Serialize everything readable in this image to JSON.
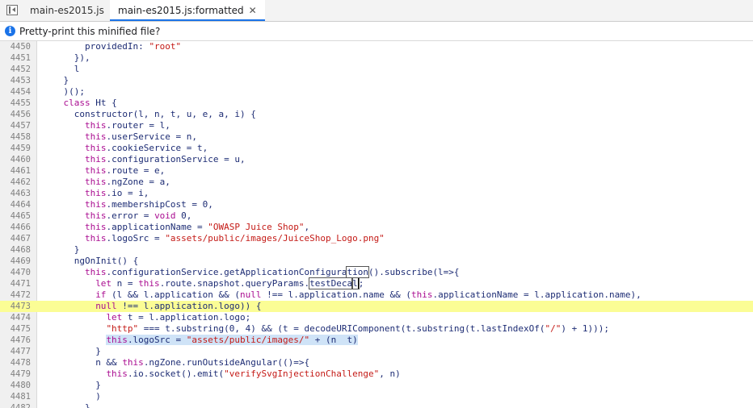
{
  "tabs": [
    {
      "label": "main-es2015.js",
      "active": false
    },
    {
      "label": "main-es2015.js:formatted",
      "active": true,
      "close": "✕"
    }
  ],
  "infobar": {
    "text": "Pretty-print this minified file?",
    "icon": "info-icon"
  },
  "accent": "#1a73e8",
  "highlight_color": "#fbfd95",
  "lines": [
    {
      "n": "4450",
      "ind": 8,
      "segs": [
        [
          "t",
          "providedIn: "
        ],
        [
          "s",
          "\"root\""
        ]
      ]
    },
    {
      "n": "4451",
      "ind": 6,
      "segs": [
        [
          "t",
          "}),"
        ]
      ]
    },
    {
      "n": "4452",
      "ind": 6,
      "segs": [
        [
          "t",
          "l"
        ]
      ]
    },
    {
      "n": "4453",
      "ind": 4,
      "segs": [
        [
          "t",
          "}"
        ]
      ]
    },
    {
      "n": "4454",
      "ind": 4,
      "segs": [
        [
          "t",
          ")();"
        ]
      ]
    },
    {
      "n": "4455",
      "ind": 4,
      "segs": [
        [
          "k",
          "class"
        ],
        [
          "t",
          " Ht {"
        ]
      ]
    },
    {
      "n": "4456",
      "ind": 6,
      "segs": [
        [
          "t",
          "constructor(l, n, t, u, e, a, i) {"
        ]
      ]
    },
    {
      "n": "4457",
      "ind": 8,
      "segs": [
        [
          "k",
          "this"
        ],
        [
          "t",
          ".router = l,"
        ]
      ]
    },
    {
      "n": "4458",
      "ind": 8,
      "segs": [
        [
          "k",
          "this"
        ],
        [
          "t",
          ".userService = n,"
        ]
      ]
    },
    {
      "n": "4459",
      "ind": 8,
      "segs": [
        [
          "k",
          "this"
        ],
        [
          "t",
          ".cookieService = t,"
        ]
      ]
    },
    {
      "n": "4460",
      "ind": 8,
      "segs": [
        [
          "k",
          "this"
        ],
        [
          "t",
          ".configurationService = u,"
        ]
      ]
    },
    {
      "n": "4461",
      "ind": 8,
      "segs": [
        [
          "k",
          "this"
        ],
        [
          "t",
          ".route = e,"
        ]
      ]
    },
    {
      "n": "4462",
      "ind": 8,
      "segs": [
        [
          "k",
          "this"
        ],
        [
          "t",
          ".ngZone = a,"
        ]
      ]
    },
    {
      "n": "4463",
      "ind": 8,
      "segs": [
        [
          "k",
          "this"
        ],
        [
          "t",
          ".io = i,"
        ]
      ]
    },
    {
      "n": "4464",
      "ind": 8,
      "segs": [
        [
          "k",
          "this"
        ],
        [
          "t",
          ".membershipCost = 0,"
        ]
      ]
    },
    {
      "n": "4465",
      "ind": 8,
      "segs": [
        [
          "k",
          "this"
        ],
        [
          "t",
          ".error = "
        ],
        [
          "k",
          "void"
        ],
        [
          "t",
          " 0,"
        ]
      ]
    },
    {
      "n": "4466",
      "ind": 8,
      "segs": [
        [
          "k",
          "this"
        ],
        [
          "t",
          ".applicationName = "
        ],
        [
          "s",
          "\"OWASP Juice Shop\""
        ],
        [
          "t",
          ","
        ]
      ]
    },
    {
      "n": "4467",
      "ind": 8,
      "segs": [
        [
          "k",
          "this"
        ],
        [
          "t",
          ".logoSrc = "
        ],
        [
          "s",
          "\"assets/public/images/JuiceShop_Logo.png\""
        ]
      ]
    },
    {
      "n": "4468",
      "ind": 6,
      "segs": [
        [
          "t",
          "}"
        ]
      ]
    },
    {
      "n": "4469",
      "ind": 6,
      "segs": [
        [
          "t",
          "ngOnInit() {"
        ]
      ]
    },
    {
      "n": "4470",
      "ind": 8,
      "segs": [
        [
          "k",
          "this"
        ],
        [
          "t",
          ".configurationService.getApplicationConfigura"
        ],
        [
          "b",
          "tion"
        ],
        [
          "t",
          "().subscribe(l=>{"
        ]
      ]
    },
    {
      "n": "4471",
      "ind": 10,
      "segs": [
        [
          "k",
          "let"
        ],
        [
          "t",
          " n = "
        ],
        [
          "k",
          "this"
        ],
        [
          "t",
          ".route.snapshot.queryParams."
        ],
        [
          "b",
          "testDeca"
        ],
        [
          "c",
          "l"
        ],
        [
          "t",
          ";"
        ]
      ]
    },
    {
      "n": "4472",
      "ind": 10,
      "segs": [
        [
          "k",
          "if"
        ],
        [
          "t",
          " (l && l.application && ("
        ],
        [
          "k",
          "null"
        ],
        [
          "t",
          " !== l.application.name && ("
        ],
        [
          "k",
          "this"
        ],
        [
          "t",
          ".applicationName = l.application.name),"
        ]
      ]
    },
    {
      "n": "4473",
      "ind": 10,
      "hl": true,
      "segs": [
        [
          "k",
          "null"
        ],
        [
          "t",
          " !== l.application.logo)) {"
        ]
      ]
    },
    {
      "n": "4474",
      "ind": 12,
      "segs": [
        [
          "k",
          "let"
        ],
        [
          "t",
          " t = l.application.logo;"
        ]
      ]
    },
    {
      "n": "4475",
      "ind": 12,
      "segs": [
        [
          "s",
          "\"http\""
        ],
        [
          "t",
          " === t.substring(0, 4) && (t = decodeURIComponent(t.substring(t.lastIndexOf("
        ],
        [
          "s",
          "\"/\""
        ],
        [
          "t",
          ") + 1)));"
        ]
      ]
    },
    {
      "n": "4476",
      "ind": 12,
      "segs": [
        [
          "sel",
          "this|.logoSrc = |\"assets/public/images/\"| + (n || t)"
        ]
      ]
    },
    {
      "n": "4477",
      "ind": 10,
      "segs": [
        [
          "t",
          "}"
        ]
      ]
    },
    {
      "n": "4478",
      "ind": 10,
      "segs": [
        [
          "t",
          "n && "
        ],
        [
          "k",
          "this"
        ],
        [
          "t",
          ".ngZone.runOutsideAngular(()=>{"
        ]
      ]
    },
    {
      "n": "4479",
      "ind": 12,
      "segs": [
        [
          "k",
          "this"
        ],
        [
          "t",
          ".io.socket().emit("
        ],
        [
          "s",
          "\"verifySvgInjectionChallenge\""
        ],
        [
          "t",
          ", n)"
        ]
      ]
    },
    {
      "n": "4480",
      "ind": 10,
      "segs": [
        [
          "t",
          "}"
        ]
      ]
    },
    {
      "n": "4481",
      "ind": 10,
      "segs": [
        [
          "t",
          ")"
        ]
      ]
    },
    {
      "n": "4482",
      "ind": 8,
      "segs": [
        [
          "t",
          "}"
        ]
      ]
    }
  ]
}
